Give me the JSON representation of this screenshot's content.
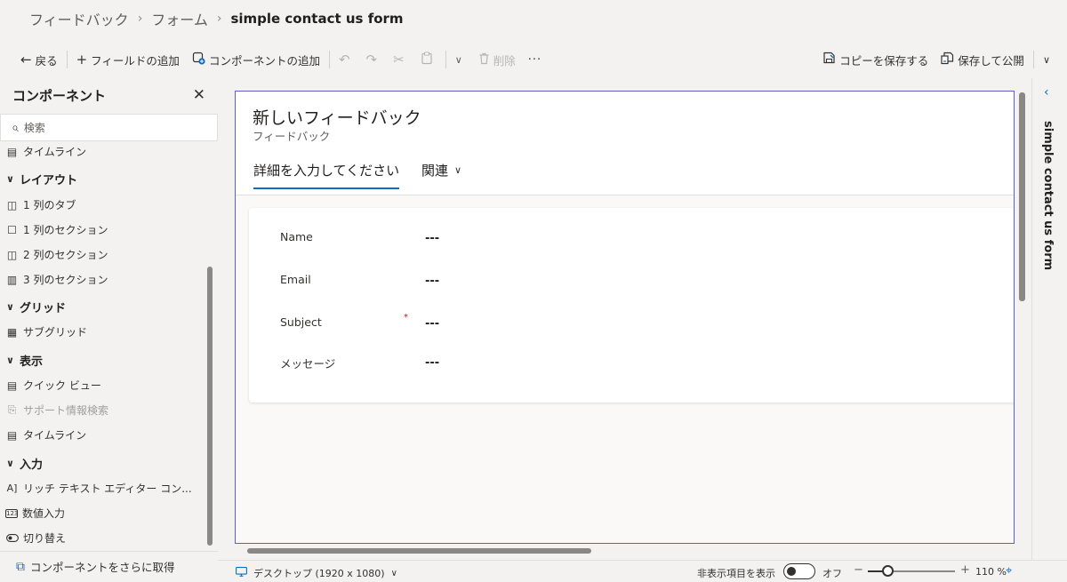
{
  "breadcrumb": {
    "items": [
      "フィードバック",
      "フォーム"
    ],
    "current": "simple contact us form"
  },
  "toolbar": {
    "back": "戻る",
    "add_field": "フィールドの追加",
    "add_component": "コンポーネントの追加",
    "delete": "削除",
    "more": "···",
    "save_copy": "コピーを保存する",
    "save_publish": "保存して公開"
  },
  "components": {
    "title": "コンポーネント",
    "search_placeholder": "検索",
    "top_item": "タイムライン",
    "groups": {
      "layout": "レイアウト",
      "grid": "グリッド",
      "display": "表示",
      "input": "入力"
    },
    "layout_items": [
      "1 列のタブ",
      "1 列のセクション",
      "2 列のセクション",
      "3 列のセクション"
    ],
    "grid_items": [
      "サブグリッド"
    ],
    "display_items": [
      "クイック ビュー",
      "サポート情報検索",
      "タイムライン"
    ],
    "input_items": [
      "リッチ テキスト エディター コン...",
      "数値入力",
      "切り替え"
    ],
    "footer": "コンポーネントをさらに取得"
  },
  "form": {
    "title": "新しいフィードバック",
    "subtitle": "フィードバック",
    "tabs": [
      "詳細を入力してください",
      "関連"
    ],
    "fields": [
      {
        "label": "Name",
        "value": "---",
        "required": false
      },
      {
        "label": "Email",
        "value": "---",
        "required": false
      },
      {
        "label": "Subject",
        "value": "---",
        "required": true,
        "marker": "*"
      },
      {
        "label": "メッセージ",
        "value": "---",
        "required": false
      }
    ]
  },
  "right_panel": {
    "label": "simple contact us form"
  },
  "status": {
    "device": "デスクトップ (1920 x 1080)",
    "show_hidden": "非表示項目を表示",
    "toggle_state": "オフ",
    "toggle_on": false,
    "zoom": "110 %",
    "zoom_fraction": 0.22
  },
  "colors": {
    "accent": "#0f6cbd",
    "canvas_border": "#5b5fc7",
    "required": "#a4262c"
  },
  "icons": {
    "back": "arrow-left-icon",
    "add": "plus-icon",
    "undo": "undo-icon",
    "redo": "redo-icon",
    "cut": "scissors-icon",
    "paste": "clipboard-icon",
    "delete": "trash-icon",
    "close": "close-icon",
    "search": "search-icon"
  }
}
